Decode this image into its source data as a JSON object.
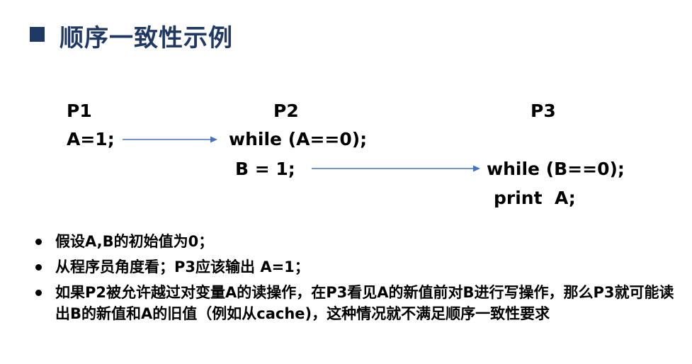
{
  "slide": {
    "title": "顺序一致性示例"
  },
  "processes": {
    "p1": {
      "label": "P1",
      "line1": "A=1;"
    },
    "p2": {
      "label": "P2",
      "line1": "while (A==0);",
      "line2": "B = 1;"
    },
    "p3": {
      "label": "P3",
      "line1": "while (B==0);",
      "line2": "print  A;"
    }
  },
  "bullets": [
    {
      "text": "假设A,B的初始值为0；"
    },
    {
      "text": "从程序员角度看；P3应该输出 A=1；"
    },
    {
      "text": "如果P2被允许越过对变量A的读操作，在P3看见A的新值前对B进行写操作，那么P3就可能读出B的新值和A的旧值（例如从cache)，这种情况就不满足顺序一致性要求"
    }
  ],
  "colors": {
    "title": "#1f3864",
    "arrow": "#4472c4"
  }
}
